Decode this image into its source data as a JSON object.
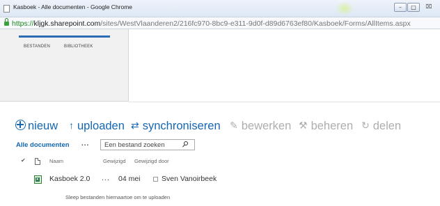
{
  "browser": {
    "window_title": "Kasboek - Alle documenten - Google Chrome",
    "url_scheme": "https://",
    "url_host": "kljgk.sharepoint.com",
    "url_path": "/sites/WestVlaanderen2/216fc970-8bc9-e311-9d0f-d89d6763ef80/Kasboek/Forms/AllItems.aspx",
    "close_glyph": "⌧",
    "minimize_glyph": "–",
    "maximize_glyph": "□"
  },
  "ribbon": {
    "tabs": [
      "BESTANDEN",
      "BIBLIOTHEEK"
    ]
  },
  "commands": {
    "new": "nieuw",
    "upload": "uploaden",
    "sync": "synchroniseren",
    "edit": "bewerken",
    "manage": "beheren",
    "share": "delen"
  },
  "view": {
    "current": "Alle documenten",
    "more": "...",
    "search_placeholder": "Een bestand zoeken"
  },
  "list": {
    "columns": {
      "name": "Naam",
      "modified": "Gewijzigd",
      "modified_by": "Gewijzigd door"
    },
    "rows": [
      {
        "name": "Kasboek 2.0",
        "more": "...",
        "modified": "04 mei",
        "modified_by": "Sven Vanoirbeek"
      }
    ]
  },
  "drop_hint": "Sleep bestanden hiernaartoe om te uploaden",
  "colors": {
    "accent": "#1567b3",
    "disabled": "#aeaeae",
    "secure": "#1d8a1d"
  }
}
